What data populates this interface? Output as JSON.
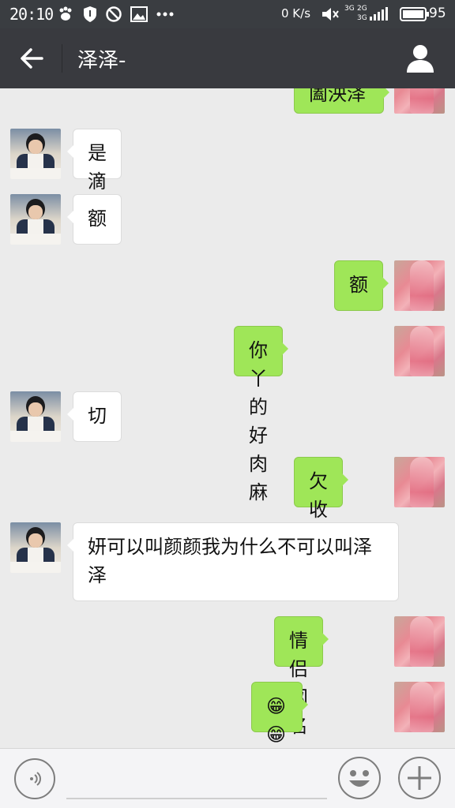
{
  "status_bar": {
    "time": "20:10",
    "network_speed": "0 K/s",
    "signal_labels": [
      "3G",
      "2G",
      "3G"
    ],
    "battery": "95"
  },
  "header": {
    "title": "泽泽-"
  },
  "messages": [
    {
      "side": "out",
      "text": "阖泱泽"
    },
    {
      "side": "in",
      "text": "是滴"
    },
    {
      "side": "in",
      "text": "额"
    },
    {
      "side": "out",
      "text": "额"
    },
    {
      "side": "out",
      "text": "你丫的好肉麻"
    },
    {
      "side": "in",
      "text": "切"
    },
    {
      "side": "out",
      "text": "欠收拾"
    },
    {
      "side": "in",
      "text": "妍可以叫颜颜我为什么不可以叫泽泽"
    },
    {
      "side": "out",
      "text": "情侣网名"
    },
    {
      "side": "out",
      "text": "😁😁😁😁"
    }
  ],
  "input": {
    "value": "",
    "placeholder": ""
  },
  "icons": {
    "back": "arrow-left-icon",
    "profile": "person-icon",
    "voice": "voice-icon",
    "emoji": "smiley-icon",
    "plus": "plus-icon"
  },
  "colors": {
    "header_bg": "#393a3f",
    "chat_bg": "#ebebeb",
    "bubble_out": "#9fe658",
    "bubble_in": "#ffffff"
  }
}
